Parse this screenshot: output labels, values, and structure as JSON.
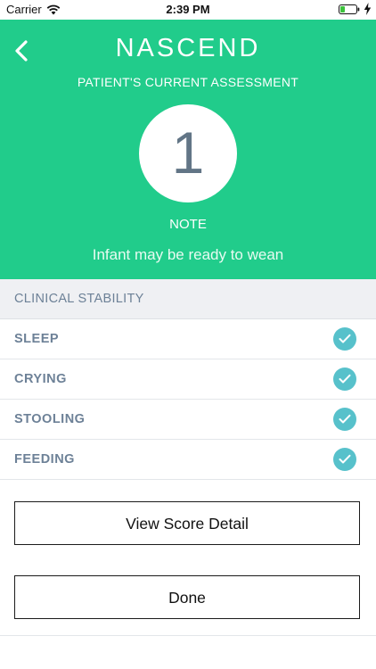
{
  "status_bar": {
    "carrier": "Carrier",
    "time": "2:39 PM"
  },
  "header": {
    "logo": "NASCEND",
    "subtitle": "PATIENT'S CURRENT ASSESSMENT",
    "score": "1",
    "note_label": "NOTE",
    "message": "Infant may be ready to wean"
  },
  "section": {
    "title": "CLINICAL STABILITY"
  },
  "items": [
    {
      "label": "SLEEP",
      "checked": true
    },
    {
      "label": "CRYING",
      "checked": true
    },
    {
      "label": "STOOLING",
      "checked": true
    },
    {
      "label": "FEEDING",
      "checked": true
    }
  ],
  "buttons": {
    "view_score_detail": "View Score Detail",
    "done": "Done"
  },
  "colors": {
    "header_green": "#21cc8b",
    "check_teal": "#57c1cb",
    "label_slate": "#6d8197"
  }
}
